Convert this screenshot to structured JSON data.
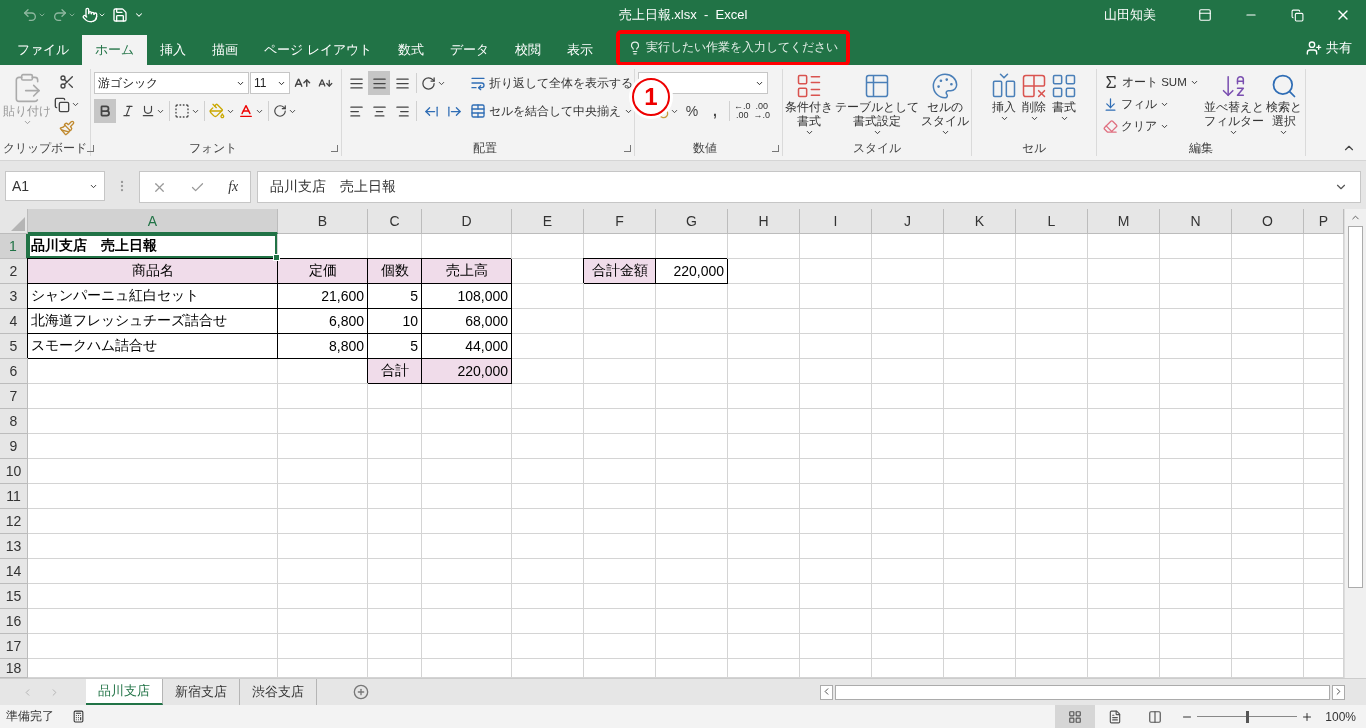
{
  "title_bar": {
    "document": "売上日報.xlsx  -  Excel",
    "user": "山田知美"
  },
  "ribbon_tabs": [
    {
      "label": "ファイル",
      "selected": false
    },
    {
      "label": "ホーム",
      "selected": true
    },
    {
      "label": "挿入",
      "selected": false
    },
    {
      "label": "描画",
      "selected": false
    },
    {
      "label": "ページ レイアウト",
      "selected": false
    },
    {
      "label": "数式",
      "selected": false
    },
    {
      "label": "データ",
      "selected": false
    },
    {
      "label": "校閲",
      "selected": false
    },
    {
      "label": "表示",
      "selected": false
    }
  ],
  "tell_me": {
    "placeholder": "実行したい作業を入力してください",
    "highlighted": true
  },
  "share": "共有",
  "callout": {
    "label": "1"
  },
  "ribbon_groups": [
    {
      "kind": "clipboard",
      "label": "クリップボード",
      "paste": "貼り付け"
    },
    {
      "kind": "font",
      "label": "フォント",
      "font_name": "游ゴシック",
      "font_size": "11",
      "bold": true,
      "italic": false,
      "underline": false
    },
    {
      "kind": "alignment",
      "label": "配置",
      "middle_align": true,
      "wrap": "折り返して全体を表示する",
      "merge": "セルを結合して中央揃え"
    },
    {
      "kind": "number",
      "label": "数値",
      "percent": "%",
      "comma": ",",
      "decimals": [
        {
          "top": "←.0",
          "bottom": ".00"
        },
        {
          "top": ".00",
          "bottom": "→.0"
        }
      ]
    },
    {
      "kind": "large",
      "label": "スタイル",
      "buttons": [
        {
          "kind": "conditional",
          "lines": [
            "条件付き",
            "書式"
          ]
        },
        {
          "kind": "table",
          "lines": [
            "テーブルとして",
            "書式設定"
          ]
        },
        {
          "kind": "cellstyle",
          "lines": [
            "セルの",
            "スタイル"
          ]
        }
      ]
    },
    {
      "kind": "large",
      "label": "セル",
      "buttons": [
        {
          "kind": "insert",
          "lines": [
            "挿入"
          ]
        },
        {
          "kind": "delete",
          "lines": [
            "削除"
          ]
        },
        {
          "kind": "format",
          "lines": [
            "書式"
          ]
        }
      ]
    },
    {
      "kind": "editing",
      "label": "編集",
      "autosum": "オート SUM",
      "fill": "フィル",
      "clear": "クリア",
      "sort": [
        "並べ替えと",
        "フィルター"
      ],
      "find": [
        "検索と",
        "選択"
      ]
    }
  ],
  "formula_bar": {
    "name_box": "A1",
    "fx": "fx",
    "formula": "品川支店　売上日報"
  },
  "columns": [
    {
      "label": "A",
      "selected": true
    },
    {
      "label": "B",
      "selected": false
    },
    {
      "label": "C",
      "selected": false
    },
    {
      "label": "D",
      "selected": false
    },
    {
      "label": "E",
      "selected": false
    },
    {
      "label": "F",
      "selected": false
    },
    {
      "label": "G",
      "selected": false
    },
    {
      "label": "H",
      "selected": false
    },
    {
      "label": "I",
      "selected": false
    },
    {
      "label": "J",
      "selected": false
    },
    {
      "label": "K",
      "selected": false
    },
    {
      "label": "L",
      "selected": false
    },
    {
      "label": "M",
      "selected": false
    },
    {
      "label": "N",
      "selected": false
    },
    {
      "label": "O",
      "selected": false
    },
    {
      "label": "P",
      "selected": false
    }
  ],
  "rows": [
    {
      "label": "1",
      "selected": true,
      "cells": [
        {
          "kind": "title",
          "text": "品川支店　売上日報",
          "selected": true
        }
      ]
    },
    {
      "label": "2",
      "selected": false,
      "cells": [
        {
          "kind": "header",
          "text": "商品名",
          "selected": false
        },
        {
          "kind": "header",
          "text": "定価",
          "selected": false
        },
        {
          "kind": "header",
          "text": "個数",
          "selected": false
        },
        {
          "kind": "header",
          "text": "売上高",
          "selected": false
        },
        {
          "kind": "blank",
          "selected": false
        },
        {
          "kind": "header",
          "text": "合計金額",
          "selected": false
        },
        {
          "kind": "number",
          "text": "220,000",
          "selected": false
        }
      ]
    },
    {
      "label": "3",
      "selected": false,
      "cells": [
        {
          "kind": "text",
          "text": "シャンパーニュ紅白セット",
          "selected": false
        },
        {
          "kind": "number",
          "text": "21,600",
          "selected": false
        },
        {
          "kind": "number",
          "text": "5",
          "selected": false
        },
        {
          "kind": "number",
          "text": "108,000",
          "selected": false
        }
      ]
    },
    {
      "label": "4",
      "selected": false,
      "cells": [
        {
          "kind": "text",
          "text": "北海道フレッシュチーズ詰合せ",
          "selected": false
        },
        {
          "kind": "number",
          "text": "6,800",
          "selected": false
        },
        {
          "kind": "number",
          "text": "10",
          "selected": false
        },
        {
          "kind": "number",
          "text": "68,000",
          "selected": false
        }
      ]
    },
    {
      "label": "5",
      "selected": false,
      "cells": [
        {
          "kind": "text",
          "text": "スモークハム詰合せ",
          "selected": false
        },
        {
          "kind": "number",
          "text": "8,800",
          "selected": false
        },
        {
          "kind": "number",
          "text": "5",
          "selected": false
        },
        {
          "kind": "number",
          "text": "44,000",
          "selected": false
        }
      ]
    },
    {
      "label": "6",
      "selected": false,
      "cells": [
        {
          "kind": "blank",
          "selected": false
        },
        {
          "kind": "blank",
          "selected": false
        },
        {
          "kind": "header",
          "text": "合計",
          "selected": false
        },
        {
          "kind": "total",
          "text": "220,000",
          "selected": false
        }
      ]
    },
    {
      "label": "7",
      "selected": false,
      "cells": []
    },
    {
      "label": "8",
      "selected": false,
      "cells": []
    },
    {
      "label": "9",
      "selected": false,
      "cells": []
    },
    {
      "label": "10",
      "selected": false,
      "cells": []
    },
    {
      "label": "11",
      "selected": false,
      "cells": []
    },
    {
      "label": "12",
      "selected": false,
      "cells": []
    },
    {
      "label": "13",
      "selected": false,
      "cells": []
    },
    {
      "label": "14",
      "selected": false,
      "cells": []
    },
    {
      "label": "15",
      "selected": false,
      "cells": []
    },
    {
      "label": "16",
      "selected": false,
      "cells": []
    },
    {
      "label": "17",
      "selected": false,
      "cells": []
    },
    {
      "label": "18",
      "selected": false,
      "cells": []
    }
  ],
  "sheet_tabs": [
    {
      "label": "品川支店",
      "selected": true
    },
    {
      "label": "新宿支店",
      "selected": false
    },
    {
      "label": "渋谷支店",
      "selected": false
    }
  ],
  "status_bar": {
    "status": "準備完了",
    "views": [
      {
        "kind": "normal",
        "selected": true
      },
      {
        "kind": "page_layout",
        "selected": false
      },
      {
        "kind": "page_break",
        "selected": false
      }
    ],
    "zoom_slider": {
      "level": 0.5
    },
    "zoom": "100%"
  }
}
